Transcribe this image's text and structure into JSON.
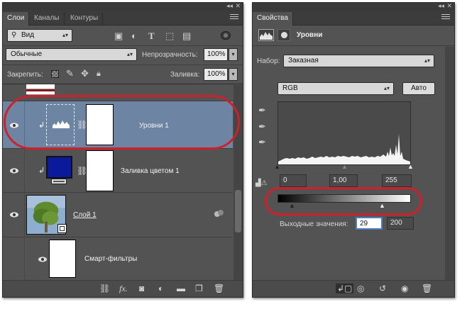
{
  "layers_panel": {
    "tabs": [
      {
        "label": "Слои"
      },
      {
        "label": "Каналы"
      },
      {
        "label": "Контуры"
      }
    ],
    "filter_kind": "Вид",
    "blend_mode": "Обычные",
    "opacity_label": "Непрозрачность:",
    "opacity_value": "100%",
    "lock_label": "Закрепить:",
    "fill_label": "Заливка:",
    "fill_value": "100%",
    "layers": [
      {
        "name": "Уровни 1",
        "type": "adjustment-levels",
        "selected": true
      },
      {
        "name": "Заливка цветом 1",
        "type": "solid-color-fill",
        "fill_color": "#0a1a9a"
      },
      {
        "name": "Слой 1",
        "type": "smart-object"
      },
      {
        "name": "Смарт-фильтры",
        "type": "smart-filters"
      }
    ]
  },
  "properties_panel": {
    "tab": "Свойства",
    "adjustment_title": "Уровни",
    "preset_label": "Набор:",
    "preset_value": "Заказная",
    "channel_value": "RGB",
    "auto_button": "Авто",
    "input_levels": {
      "black": "0",
      "gamma": "1,00",
      "white": "255"
    },
    "output_label": "Выходные значения:",
    "output_levels": {
      "black": "29",
      "white": "200"
    }
  },
  "colors": {
    "panel_bg": "#535353",
    "selected_row": "#6e84a3",
    "highlight_oval": "#d11f2a"
  }
}
